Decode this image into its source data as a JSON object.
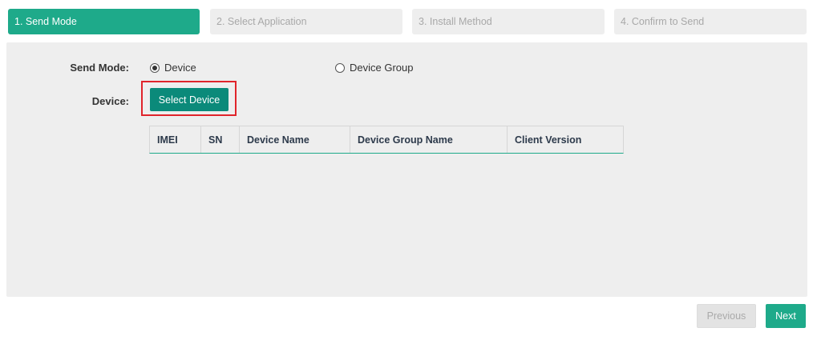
{
  "steps": [
    {
      "label": "1. Send Mode",
      "active": true
    },
    {
      "label": "2. Select Application",
      "active": false
    },
    {
      "label": "3. Install Method",
      "active": false
    },
    {
      "label": "4. Confirm to Send",
      "active": false
    }
  ],
  "form": {
    "send_mode_label": "Send Mode:",
    "radio_device": {
      "label": "Device",
      "checked": true
    },
    "radio_device_group": {
      "label": "Device Group",
      "checked": false
    },
    "device_label": "Device:",
    "select_device_button": "Select Device"
  },
  "table": {
    "columns": [
      "IMEI",
      "SN",
      "Device Name",
      "Device Group Name",
      "Client Version"
    ],
    "rows": []
  },
  "footer": {
    "previous_label": "Previous",
    "next_label": "Next"
  },
  "colors": {
    "accent": "#1eaa8a",
    "button_dark": "#0b8a7a",
    "highlight_border": "#e0242b"
  }
}
